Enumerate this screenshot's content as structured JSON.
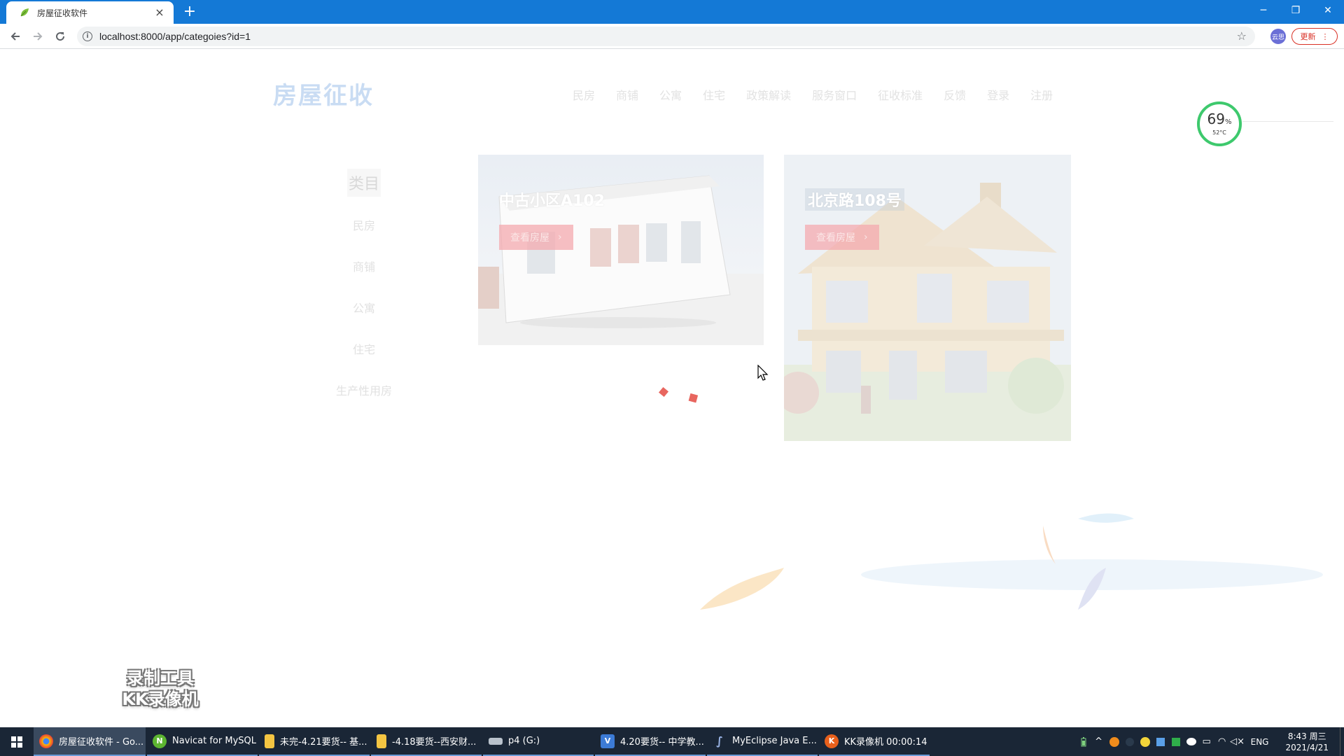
{
  "browser": {
    "tab_title": "房屋征收软件",
    "close_glyph": "×",
    "newtab_glyph": "+",
    "url": "localhost:8000/app/categoies?id=1",
    "profile_label": "云思",
    "update_label": "更新",
    "window_controls": {
      "minimize": "─",
      "restore": "❐",
      "close": "✕"
    }
  },
  "site": {
    "logo": "房屋征收",
    "nav": [
      "民房",
      "商铺",
      "公寓",
      "住宅",
      "政策解读",
      "服务窗口",
      "征收标准",
      "反馈",
      "登录",
      "注册"
    ]
  },
  "sidebar": {
    "title": "类目",
    "items": [
      "民房",
      "商铺",
      "公寓",
      "住宅",
      "生产性用房"
    ]
  },
  "cards": [
    {
      "title": "中古小区A102",
      "button": "查看房屋"
    },
    {
      "title": "北京路108号",
      "button": "查看房屋"
    }
  ],
  "cpu_widget": {
    "percent": "69",
    "unit": "%",
    "temp": "52°C"
  },
  "watermark": {
    "line1": "录制工具",
    "line2": "KK录像机"
  },
  "taskbar": {
    "items": [
      {
        "label": "房屋征收软件 - Go...",
        "icon": "chrome-icon"
      },
      {
        "label": "Navicat for MySQL",
        "icon": "navicat-icon"
      },
      {
        "label": "未完-4.21要货-- 基...",
        "icon": "folder-icon"
      },
      {
        "label": "-4.18要货--西安财...",
        "icon": "folder-icon"
      },
      {
        "label": "p4 (G:)",
        "icon": "drive-icon"
      },
      {
        "label": "4.20要货-- 中学教...",
        "icon": "vs-icon"
      },
      {
        "label": "MyEclipse Java E...",
        "icon": "myeclipse-icon"
      },
      {
        "label": "KK录像机 00:00:14",
        "icon": "kk-icon"
      }
    ],
    "language": "ENG",
    "time": "8:43 周三",
    "date": "2021/4/21"
  },
  "colors": {
    "titlebar": "#1479d6",
    "taskbar": "#1a2636",
    "logo": "#c9dcf3",
    "button_red": "#f4aaaf",
    "cpu_ring": "#3ec96d"
  }
}
